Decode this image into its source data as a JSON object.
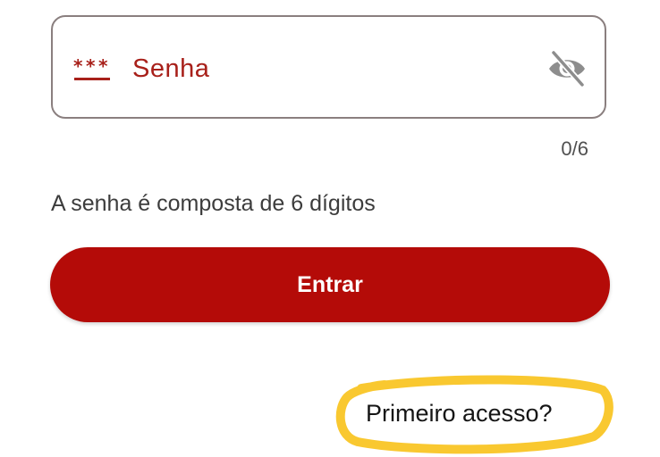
{
  "password_field": {
    "label": "Senha",
    "value": "",
    "lead_icon": "password-asterisks-icon",
    "toggle_icon": "eye-off-icon",
    "counter": "0/6"
  },
  "helper_text": "A senha é composta de 6 dígitos",
  "enter_button": {
    "label": "Entrar"
  },
  "first_access": {
    "label": "Primeiro acesso?"
  },
  "colors": {
    "brand_red": "#b40b08",
    "label_red": "#a8201a",
    "highlight_yellow": "#f8c21a",
    "field_border": "#8a7f7f"
  }
}
